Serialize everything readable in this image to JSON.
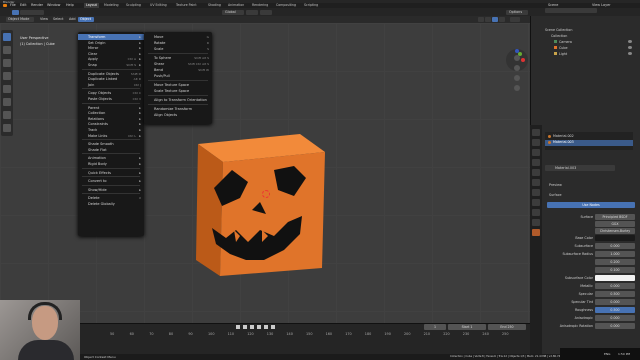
{
  "app_title": "Blender",
  "menubar": {
    "items": [
      "File",
      "Edit",
      "Render",
      "Window",
      "Help"
    ],
    "workspaces": [
      "Layout",
      "Modeling",
      "Sculpting",
      "UV Editing",
      "Texture Paint",
      "Shading",
      "Animation",
      "Rendering",
      "Compositing",
      "Scripting"
    ],
    "active_workspace": "Layout",
    "scene_label": "Scene",
    "view_layer_label": "View Layer"
  },
  "header": {
    "mode": "Object Mode",
    "menus": [
      "View",
      "Select",
      "Add",
      "Object"
    ],
    "transform_orientation": "Global",
    "options_label": "Options"
  },
  "viewport": {
    "view_name": "User Perspective",
    "collection_label": "(1) Collection | Cube"
  },
  "object_menu": {
    "items": [
      {
        "label": "Transform",
        "submenu": true,
        "highlight": true
      },
      {
        "label": "Set Origin",
        "submenu": true
      },
      {
        "label": "Mirror",
        "submenu": true
      },
      {
        "label": "Clear",
        "submenu": true
      },
      {
        "label": "Apply",
        "submenu": true,
        "shortcut": "Ctrl A"
      },
      {
        "label": "Snap",
        "submenu": true,
        "shortcut": "Shift S"
      },
      {
        "label": "",
        "divider": true
      },
      {
        "label": "Duplicate Objects",
        "shortcut": "Shift D"
      },
      {
        "label": "Duplicate Linked",
        "shortcut": "Alt D"
      },
      {
        "label": "Join",
        "shortcut": "Ctrl J"
      },
      {
        "label": "",
        "divider": true
      },
      {
        "label": "Copy Objects",
        "shortcut": "Ctrl C"
      },
      {
        "label": "Paste Objects",
        "shortcut": "Ctrl V"
      },
      {
        "label": "",
        "divider": true
      },
      {
        "label": "Parent",
        "submenu": true
      },
      {
        "label": "Collection",
        "submenu": true
      },
      {
        "label": "Relations",
        "submenu": true
      },
      {
        "label": "Constraints",
        "submenu": true
      },
      {
        "label": "Track",
        "submenu": true
      },
      {
        "label": "Make Links",
        "submenu": true,
        "shortcut": "Ctrl L"
      },
      {
        "label": "",
        "divider": true
      },
      {
        "label": "Shade Smooth"
      },
      {
        "label": "Shade Flat"
      },
      {
        "label": "",
        "divider": true
      },
      {
        "label": "Animation",
        "submenu": true
      },
      {
        "label": "Rigid Body",
        "submenu": true
      },
      {
        "label": "",
        "divider": true
      },
      {
        "label": "Quick Effects",
        "submenu": true
      },
      {
        "label": "",
        "divider": true
      },
      {
        "label": "Convert to",
        "submenu": true
      },
      {
        "label": "",
        "divider": true
      },
      {
        "label": "Show/Hide",
        "submenu": true
      },
      {
        "label": "",
        "divider": true
      },
      {
        "label": "Delete",
        "shortcut": "X"
      },
      {
        "label": "Delete Globally"
      }
    ]
  },
  "transform_submenu": {
    "items": [
      {
        "label": "Move",
        "shortcut": "G"
      },
      {
        "label": "Rotate",
        "shortcut": "R"
      },
      {
        "label": "Scale",
        "shortcut": "S"
      },
      {
        "label": "",
        "divider": true
      },
      {
        "label": "To Sphere",
        "shortcut": "Shift Alt S"
      },
      {
        "label": "Shear",
        "shortcut": "Shift Ctrl Alt S"
      },
      {
        "label": "Bend",
        "shortcut": "Shift W"
      },
      {
        "label": "Push/Pull"
      },
      {
        "label": "",
        "divider": true
      },
      {
        "label": "Move Texture Space"
      },
      {
        "label": "Scale Texture Space"
      },
      {
        "label": "",
        "divider": true
      },
      {
        "label": "Align to Transform Orientation"
      },
      {
        "label": "",
        "divider": true
      },
      {
        "label": "Randomize Transform"
      },
      {
        "label": "Align Objects"
      }
    ]
  },
  "outliner": {
    "root": "Scene Collection",
    "items": [
      "Collection",
      "Camera",
      "Cube",
      "Light"
    ]
  },
  "properties": {
    "slots": [
      "Material.002",
      "Material.003"
    ],
    "material_name": "Material.003",
    "sections": [
      "Preview",
      "Surface"
    ],
    "use_nodes_label": "Use Nodes",
    "rows": [
      {
        "label": "Surface",
        "value": "Principled BSDF"
      },
      {
        "label": "",
        "value": "GGX"
      },
      {
        "label": "",
        "value": "Christensen-Burley"
      },
      {
        "label": "Base Color",
        "value": ""
      },
      {
        "label": "Subsurface",
        "value": "0.000"
      },
      {
        "label": "Subsurface Radius",
        "value": "1.000"
      },
      {
        "label": "",
        "value": "0.200"
      },
      {
        "label": "",
        "value": "0.100"
      },
      {
        "label": "Subsurface Color",
        "value": ""
      },
      {
        "label": "Metallic",
        "value": "0.000"
      },
      {
        "label": "Specular",
        "value": "0.500"
      },
      {
        "label": "Specular Tint",
        "value": "0.000"
      },
      {
        "label": "Roughness",
        "value": "0.500"
      },
      {
        "label": "Anisotropic",
        "value": "0.000"
      },
      {
        "label": "Anisotropic Rotation",
        "value": "0.000"
      }
    ]
  },
  "timeline": {
    "start_label": "Start",
    "start_value": "1",
    "end_label": "End",
    "end_value": "250",
    "current_frame": "1",
    "ticks": [
      "50",
      "60",
      "70",
      "80",
      "90",
      "100",
      "110",
      "120",
      "130",
      "140",
      "150",
      "160",
      "170",
      "180",
      "190",
      "200",
      "210",
      "220",
      "230",
      "240",
      "250"
    ]
  },
  "status": {
    "left": "Object Context Menu",
    "right": "Collection | Cube | Verts:8 | Faces:6 | Tris:12 | Objects:1/3 | Mem: 21.4 MiB | v2.80.74",
    "time": "1:50 PM",
    "lang": "ENG"
  },
  "colors": {
    "accent": "#4772b3",
    "pumpkin": "#e0742a",
    "camera_tag": "#4d8a5c",
    "material_dot": "#c8742a"
  }
}
